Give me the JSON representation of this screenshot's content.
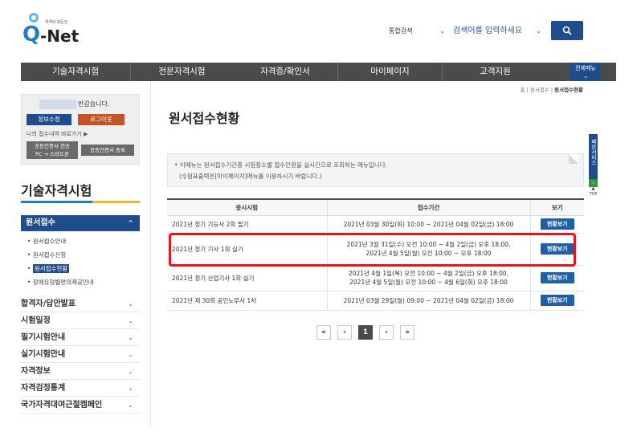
{
  "header": {
    "logo_tagline": "자격의 모든것",
    "logo_q": "Q",
    "logo_net": "-Net",
    "search_scope": "통합검색",
    "search_placeholder": "검색어를 입력하세요"
  },
  "nav": {
    "items": [
      "기술자격시험",
      "전문자격시험",
      "자격증/확인서",
      "마이페이지",
      "고객지원"
    ],
    "all_menu": "전체메뉴"
  },
  "login": {
    "greeting": "반갑습니다.",
    "info_edit": "정보수정",
    "logout": "로그아웃",
    "quick_link": "나의 접수내역 바로가기",
    "cert_pc_line1": "공동인증서 전송",
    "cert_pc_line2": "PC → 스마트폰",
    "cert_register": "공동인증서 등록"
  },
  "sidebar": {
    "title": "기술자격시험",
    "active_menu": "원서접수",
    "sub_items": [
      "원서접수안내",
      "원서접수신청",
      "원서접수현황",
      "장애유형별편의제공안내"
    ],
    "menus": [
      "합격자/답안발표",
      "시험일정",
      "필기시험안내",
      "실기시험안내",
      "자격정보",
      "자격검정통계",
      "국가자격대여근절캠페인"
    ]
  },
  "breadcrumb": {
    "home": "홈",
    "parent": "원서접수",
    "current": "원서접수현황"
  },
  "main": {
    "title": "원서접수현황",
    "notice_line1": "이메뉴는 원서접수기간중 시험장소별 접수인원을 실시간으로 조회하는 메뉴입니다.",
    "notice_line2": "(수험표출력은[마이페이지]메뉴를 이용하시기 바랍니다.)"
  },
  "table": {
    "headers": [
      "응시시험",
      "접수기간",
      "보기"
    ],
    "rows": [
      {
        "exam": "2021년 정기 기능사 2회 필기",
        "period_line1": "2021년 03월 30일(화) 10:00 ~ 2021년 04월 02일(금) 18:00",
        "period_line2": "",
        "action": "현황보기"
      },
      {
        "exam": "2021년 정기 기사 1회 실기",
        "period_line1": "2021년 3월 31일(수) 오전 10:00 ~ 4월 2일(금) 오후 18:00,",
        "period_line2": "2021년 4월 5일(월) 오전 10:00 ~ 오후 18:00",
        "action": "현황보기"
      },
      {
        "exam": "2021년 정기 산업기사 1회 실기",
        "period_line1": "2021년 4월 1일(목) 오전 10:00 ~ 4월 2일(금) 오후 18:00,",
        "period_line2": "2021년 4월 5일(월) 오전 10:00 ~ 4월 6일(화) 오후 18:00",
        "action": "현황보기"
      },
      {
        "exam": "2021년 제 30회 공인노무사 1차",
        "period_line1": "2021년 03월 29일(월) 09:00 ~ 2021년 04월 02일(금) 18:00",
        "period_line2": "",
        "action": "현황보기"
      }
    ]
  },
  "pager": {
    "first": "«",
    "prev": "‹",
    "current": "1",
    "next": "›",
    "last": "»"
  },
  "side_tab": {
    "label": "빠른서비스",
    "top": "TOP"
  },
  "colors": {
    "brand_blue": "#1f4d8c",
    "nav_gray": "#4b4b4b",
    "logout_orange": "#c2542a",
    "highlight_red": "#e8141c"
  }
}
